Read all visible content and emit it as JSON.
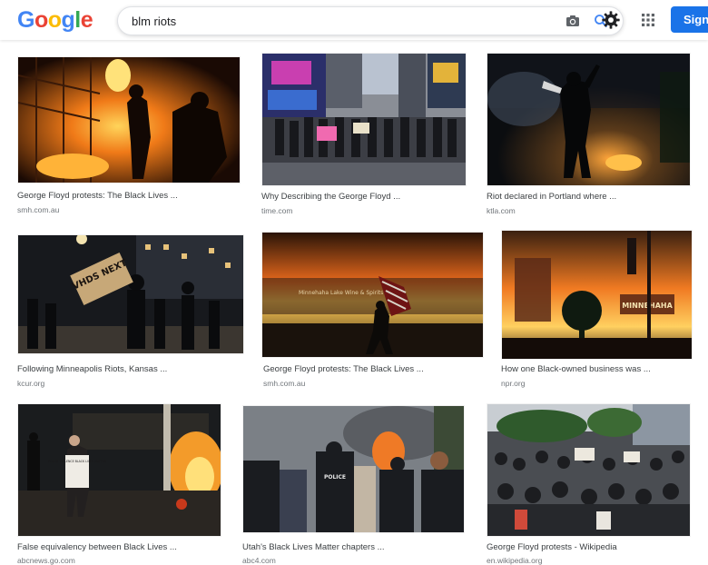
{
  "logo": {
    "letters": [
      "G",
      "o",
      "o",
      "g",
      "l",
      "e"
    ]
  },
  "search": {
    "query": "blm riots"
  },
  "header": {
    "signin_label": "Sign"
  },
  "icons": {
    "camera": "camera-icon",
    "search": "search-icon",
    "settings": "gear-icon",
    "apps": "apps-grid-icon"
  },
  "colors": {
    "google_blue": "#4285f4",
    "google_red": "#ea4335",
    "google_yellow": "#fbbc05",
    "google_green": "#34a853",
    "signin_blue": "#1a73e8"
  },
  "results": [
    {
      "title": "George Floyd protests: The Black Lives ...",
      "source": "smh.com.au"
    },
    {
      "title": "Why Describing the George Floyd ...",
      "source": "time.com"
    },
    {
      "title": "Riot declared in Portland where ...",
      "source": "ktla.com"
    },
    {
      "title": "Following Minneapolis Riots, Kansas ...",
      "source": "kcur.org"
    },
    {
      "title": "George Floyd protests: The Black Lives ...",
      "source": "smh.com.au"
    },
    {
      "title": "How one Black-owned business was ...",
      "source": "npr.org"
    },
    {
      "title": "False equivalency between Black Lives ...",
      "source": "abcnews.go.com"
    },
    {
      "title": "Utah's Black Lives Matter chapters ...",
      "source": "abc4.com"
    },
    {
      "title": "George Floyd protests - Wikipedia",
      "source": "en.wikipedia.org"
    }
  ],
  "image_text": {
    "sign_1": "VHDS NEXT",
    "sign_2": "POLICE VIOLENCE BLACK LIVES MATTER",
    "storefront": "MINNEHAHA",
    "police_vest": "POLICE"
  }
}
